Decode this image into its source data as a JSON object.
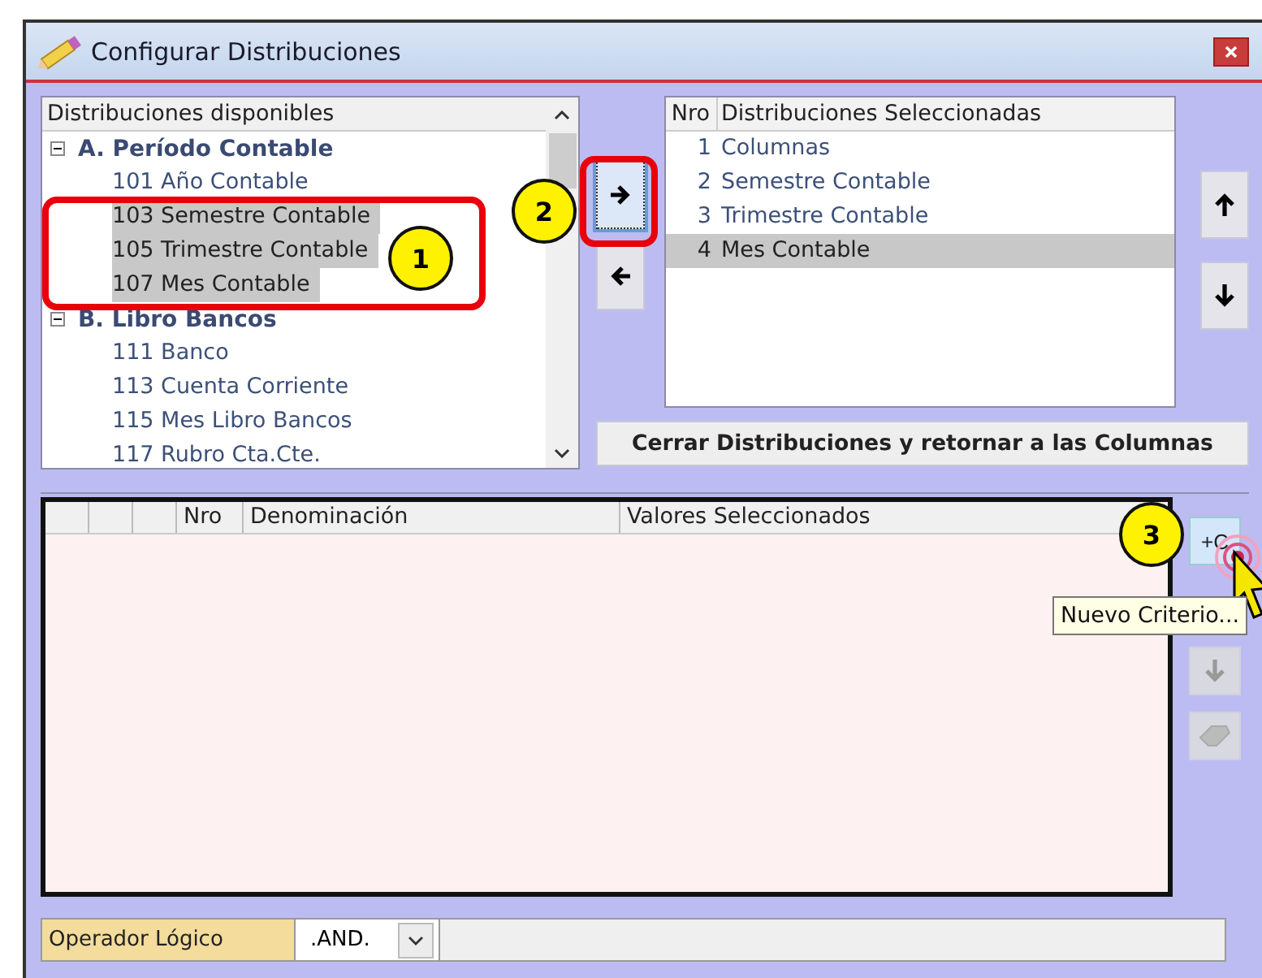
{
  "window": {
    "title": "Configurar Distribuciones"
  },
  "available_tree": {
    "header": "Distribuciones disponibles",
    "groups": [
      {
        "label": "A. Período Contable",
        "expanded": true,
        "children": [
          {
            "label": "101 Año Contable",
            "selected": false
          },
          {
            "label": "103 Semestre Contable",
            "selected": true
          },
          {
            "label": "105 Trimestre Contable",
            "selected": true
          },
          {
            "label": "107 Mes Contable",
            "selected": true
          }
        ]
      },
      {
        "label": "B. Libro Bancos",
        "expanded": true,
        "children": [
          {
            "label": "111 Banco",
            "selected": false
          },
          {
            "label": "113 Cuenta Corriente",
            "selected": false
          },
          {
            "label": "115 Mes Libro Bancos",
            "selected": false
          },
          {
            "label": "117 Rubro Cta.Cte.",
            "selected": false
          }
        ]
      }
    ]
  },
  "selected_list": {
    "columns": [
      "Nro",
      "Distribuciones Seleccionadas"
    ],
    "rows": [
      {
        "nro": "1",
        "name": "Columnas",
        "selected": false
      },
      {
        "nro": "2",
        "name": "Semestre Contable",
        "selected": false
      },
      {
        "nro": "3",
        "name": "Trimestre Contable",
        "selected": false
      },
      {
        "nro": "4",
        "name": "Mes Contable",
        "selected": true
      }
    ]
  },
  "close_button": "Cerrar Distribuciones y retornar a las Columnas",
  "criteria_grid": {
    "columns": [
      "Nro",
      "Denominación",
      "Valores Seleccionados"
    ]
  },
  "new_criterion_button": {
    "label": "+C",
    "tooltip": "Nuevo Criterio..."
  },
  "operator": {
    "label": "Operador Lógico",
    "value": ".AND."
  },
  "callouts": [
    "1",
    "2",
    "3"
  ]
}
